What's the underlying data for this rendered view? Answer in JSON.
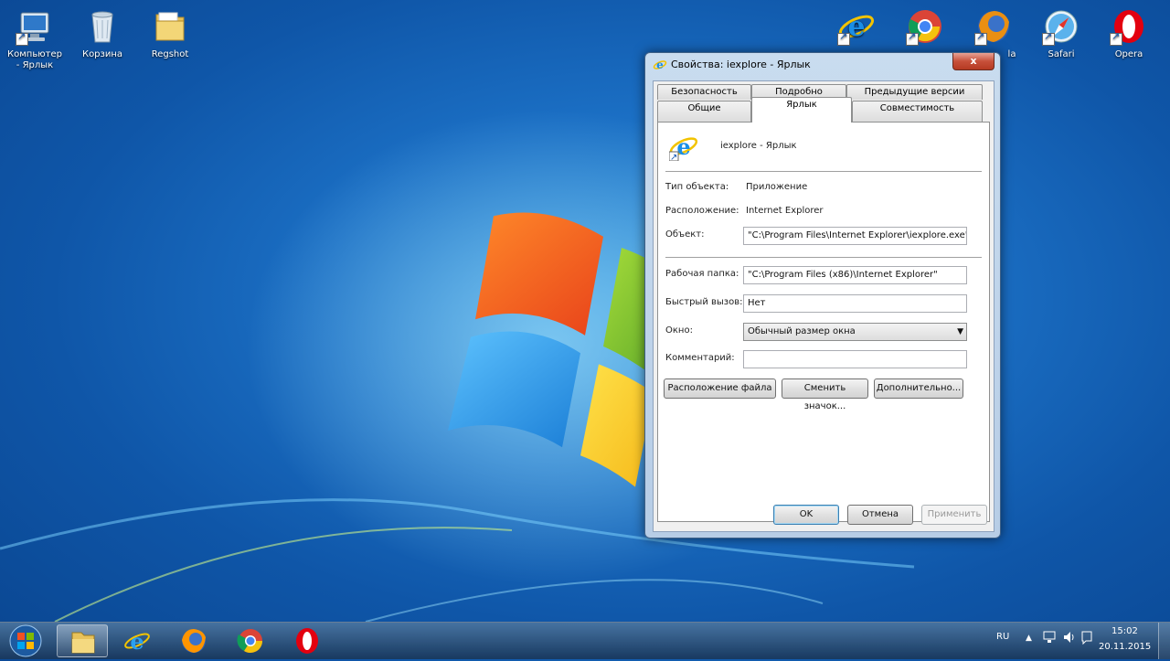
{
  "desktop": {
    "left_icons": [
      {
        "label": "Компьютер\n- Ярлык",
        "icon": "computer-icon"
      },
      {
        "label": "Корзина",
        "icon": "recycle-bin-icon"
      },
      {
        "label": "Regshot",
        "icon": "folder-icon"
      }
    ],
    "right_icons": [
      {
        "label": "",
        "icon": "internet-explorer-icon"
      },
      {
        "label": "",
        "icon": "chrome-icon"
      },
      {
        "label": "la",
        "icon": "firefox-icon"
      },
      {
        "label": "Safari",
        "icon": "safari-icon"
      },
      {
        "label": "Opera",
        "icon": "opera-icon"
      }
    ]
  },
  "dialog": {
    "title": "Свойства: iexplore - Ярлык",
    "close_label": "x",
    "tabs_row1": [
      "Безопасность",
      "Подробно",
      "Предыдущие версии"
    ],
    "tabs_row2": [
      "Общие",
      "Ярлык",
      "Совместимость"
    ],
    "active_tab": "Ярлык",
    "shortcut_name": "iexplore - Ярлык",
    "type_label": "Тип объекта:",
    "type_value": "Приложение",
    "location_label": "Расположение:",
    "location_value": "Internet Explorer",
    "target_label": "Объект:",
    "target_value": "\"C:\\Program Files\\Internet Explorer\\iexplore.exe\"",
    "startin_label": "Рабочая папка:",
    "startin_value": "\"C:\\Program Files (x86)\\Internet Explorer\"",
    "hotkey_label": "Быстрый вызов:",
    "hotkey_value": "Нет",
    "run_label": "Окно:",
    "run_value": "Обычный размер окна",
    "comment_label": "Комментарий:",
    "comment_value": "",
    "btn_open_location": "Расположение файла",
    "btn_change_icon": "Сменить значок...",
    "btn_advanced": "Дополнительно...",
    "ok": "OK",
    "cancel": "Отмена",
    "apply": "Применить"
  },
  "taskbar": {
    "items": [
      "explorer-icon",
      "internet-explorer-icon",
      "firefox-icon",
      "chrome-icon",
      "opera-icon"
    ],
    "lang": "RU",
    "time": "15:02",
    "date": "20.11.2015"
  }
}
